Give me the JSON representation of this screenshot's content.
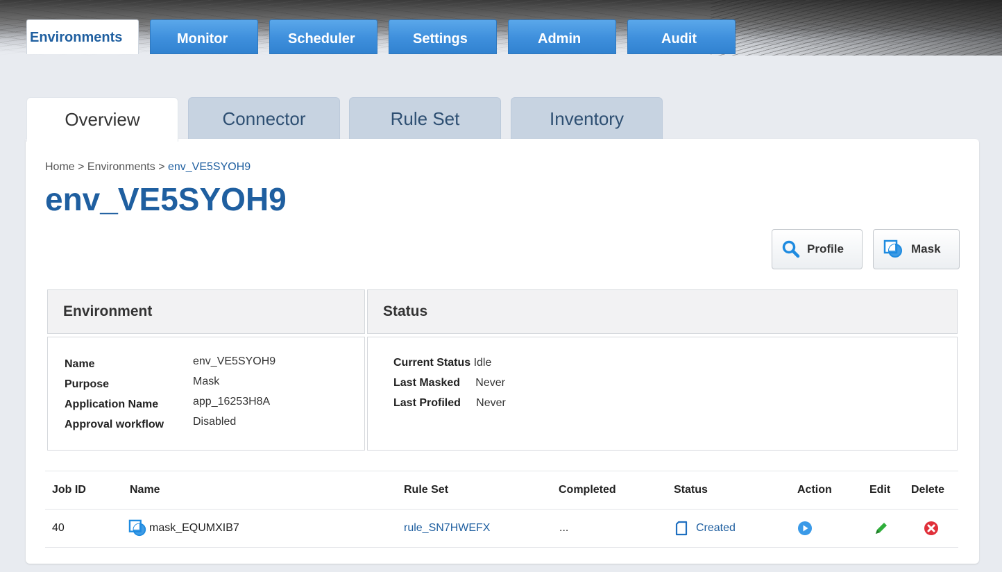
{
  "main_nav": {
    "tabs": [
      {
        "label": "Environments",
        "active": true
      },
      {
        "label": "Monitor",
        "active": false
      },
      {
        "label": "Scheduler",
        "active": false
      },
      {
        "label": "Settings",
        "active": false
      },
      {
        "label": "Admin",
        "active": false
      },
      {
        "label": "Audit",
        "active": false
      }
    ]
  },
  "sub_nav": {
    "tabs": [
      {
        "label": "Overview",
        "active": true
      },
      {
        "label": "Connector",
        "active": false
      },
      {
        "label": "Rule Set",
        "active": false
      },
      {
        "label": "Inventory",
        "active": false
      }
    ]
  },
  "breadcrumb": {
    "home": "Home",
    "sep1": " > ",
    "environments": "Environments",
    "sep2": " > ",
    "current": "env_VE5SYOH9"
  },
  "page_title": "env_VE5SYOH9",
  "actions": {
    "profile_label": "Profile",
    "mask_label": "Mask"
  },
  "environment_panel": {
    "title": "Environment",
    "fields": [
      {
        "label": "Name",
        "value": "env_VE5SYOH9"
      },
      {
        "label": "Purpose",
        "value": "Mask"
      },
      {
        "label": "Application Name",
        "value": "app_16253H8A"
      },
      {
        "label": "Approval workflow",
        "value": "Disabled"
      }
    ]
  },
  "status_panel": {
    "title": "Status",
    "fields": [
      {
        "label": "Current Status",
        "value": "Idle"
      },
      {
        "label": "Last Masked",
        "value": "Never"
      },
      {
        "label": "Last Profiled",
        "value": "Never"
      }
    ]
  },
  "jobs_table": {
    "headers": [
      "Job ID",
      "Name",
      "Rule Set",
      "Completed",
      "Status",
      "Action",
      "Edit",
      "Delete"
    ],
    "rows": [
      {
        "job_id": "40",
        "name": "mask_EQUMXIB7",
        "rule_set": "rule_SN7HWEFX",
        "completed": "...",
        "status": "Created"
      }
    ]
  },
  "colors": {
    "accent": "#1f5fa0",
    "tab_blue": "#3e8fdc",
    "run_icon": "#3a9ae8",
    "edit_icon": "#2fae3a",
    "delete_icon": "#e0303a"
  }
}
